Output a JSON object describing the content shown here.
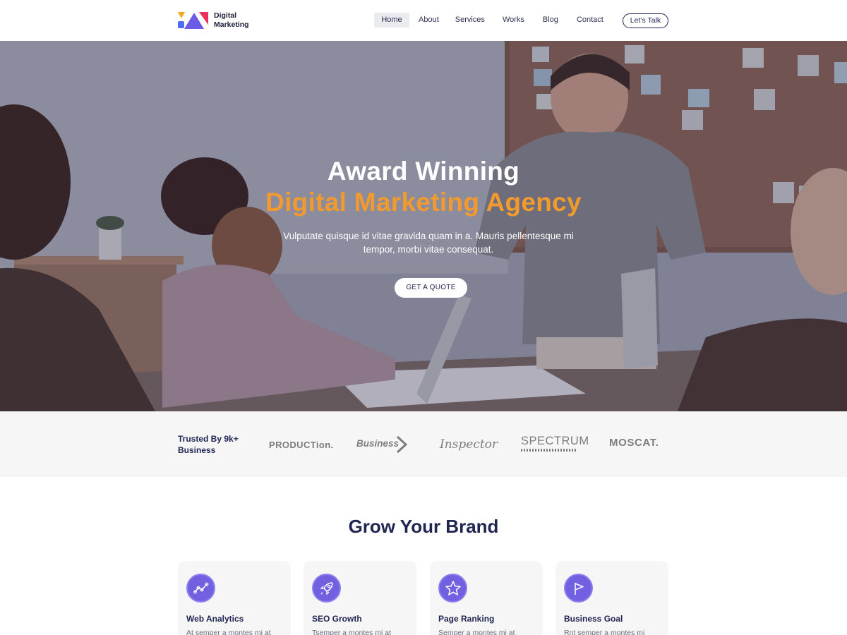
{
  "header": {
    "logo_line1": "Digital",
    "logo_line2": "Marketing",
    "nav": [
      {
        "label": "Home",
        "active": true
      },
      {
        "label": "About"
      },
      {
        "label": "Services"
      },
      {
        "label": "Works"
      },
      {
        "label": "Blog"
      },
      {
        "label": "Contact"
      }
    ],
    "cta_label": "Let’s Talk"
  },
  "hero": {
    "title_line1": "Award Winning",
    "title_line2": "Digital Marketing Agency",
    "description": "Vulputate quisque id vitae gravida quam in a. Mauris pellentesque mi tempor, morbi vitae consequat.",
    "button_label": "GET A QUOTE"
  },
  "trusted": {
    "label": "Trusted By 9k+ Business",
    "brands": [
      "PRODUCTion.",
      "Business",
      "Inspector",
      "SPECTRUM",
      "MOSCAT."
    ]
  },
  "grow": {
    "title": "Grow Your Brand",
    "cards": [
      {
        "title": "Web Analytics",
        "description": "At semper a montes mi at",
        "icon": "analytics-icon"
      },
      {
        "title": "SEO Growth",
        "description": "Tsemper a montes mi at",
        "icon": "rocket-icon"
      },
      {
        "title": "Page Ranking",
        "description": "Semper a montes mi at",
        "icon": "star-icon"
      },
      {
        "title": "Business Goal",
        "description": "Rnt semper a montes mi",
        "icon": "flag-icon"
      }
    ]
  },
  "colors": {
    "accent_orange": "#f29a2e",
    "navy": "#1f2551",
    "icon_purple": "#7160e0",
    "band_gray": "#f6f6f6"
  }
}
